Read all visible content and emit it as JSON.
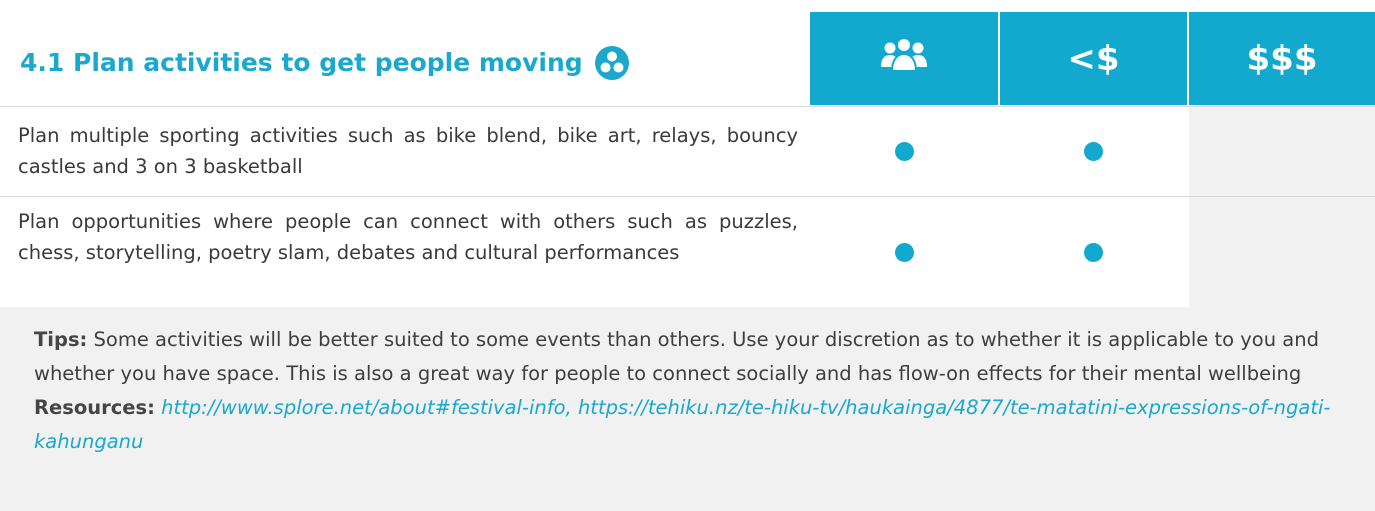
{
  "header": {
    "title": "4.1 Plan activities to get people moving",
    "title_icon": "molecule-circle-icon",
    "columns": [
      {
        "icon": "people-group-icon",
        "label": ""
      },
      {
        "label": "<$"
      },
      {
        "label": "$$$"
      }
    ]
  },
  "rows": [
    {
      "text": "Plan multiple sporting activities such as bike blend, bike art, relays, bouncy castles and 3 on 3 basketball",
      "marks": [
        true,
        true,
        false
      ]
    },
    {
      "text": "Plan opportunities where people can connect with others such as puzzles, chess, storytelling, poetry slam, debates and cultural performances",
      "marks": [
        true,
        true,
        false
      ]
    }
  ],
  "tips": {
    "tips_label": "Tips:",
    "tips_text": " Some activities will be better suited to some events than others. Use your discretion as to whether it is applicable to you and whether you have space. This is also a great way for people to connect socially and has flow-on effects for their mental wellbeing",
    "resources_label": "Resources:",
    "resources_text": " http://www.splore.net/about#festival-info, https://tehiku.nz/te-hiku-tv/haukainga/4877/te-matatini-expressions-of-ngati-kahunganu"
  },
  "colors": {
    "accent": "#13a9cf",
    "title": "#1ba8cc",
    "shade": "#f1f1f1"
  }
}
